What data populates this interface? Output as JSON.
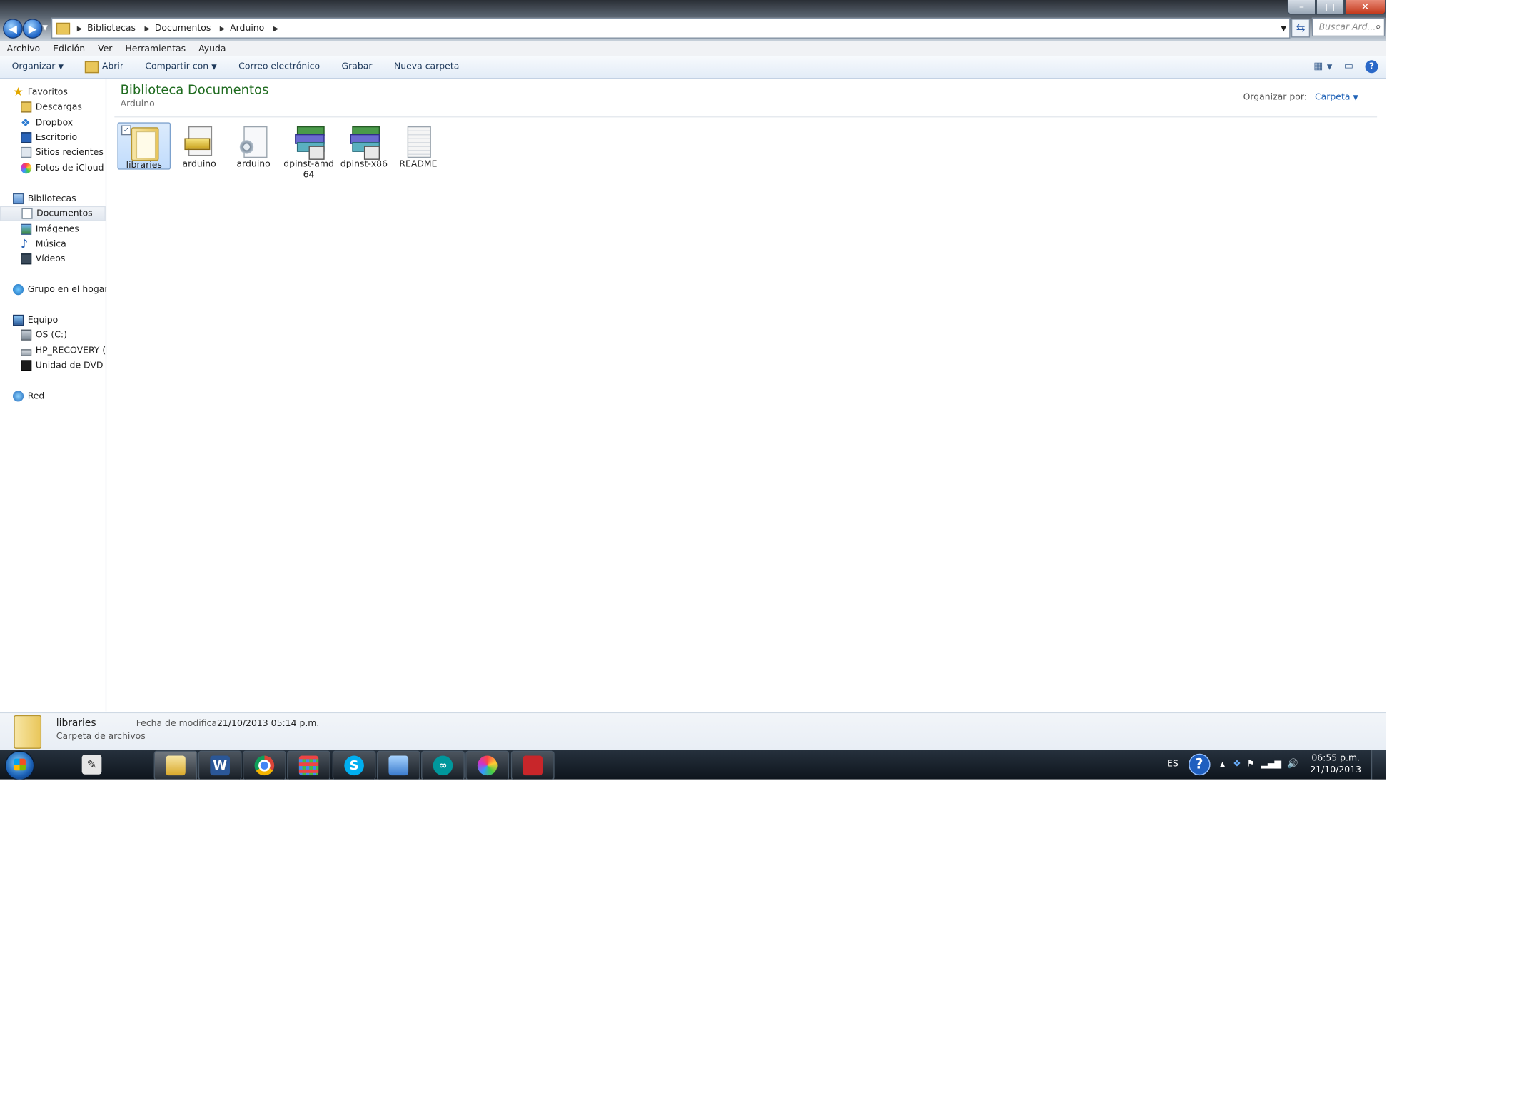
{
  "window": {
    "caption": {
      "minimize": "–",
      "maximize": "□",
      "close": "✕"
    }
  },
  "address_bar": {
    "breadcrumbs": [
      "Bibliotecas",
      "Documentos",
      "Arduino"
    ],
    "search_placeholder": "Buscar Ard..."
  },
  "menu": [
    "Archivo",
    "Edición",
    "Ver",
    "Herramientas",
    "Ayuda"
  ],
  "toolbar": {
    "organize": "Organizar",
    "open": "Abrir",
    "share": "Compartir con",
    "email": "Correo electrónico",
    "burn": "Grabar",
    "new_folder": "Nueva carpeta"
  },
  "sidebar": {
    "favorites": {
      "header": "Favoritos",
      "items": [
        "Descargas",
        "Dropbox",
        "Escritorio",
        "Sitios recientes",
        "Fotos de iCloud"
      ]
    },
    "libraries": {
      "header": "Bibliotecas",
      "items": [
        "Documentos",
        "Imágenes",
        "Música",
        "Vídeos"
      ],
      "selected": "Documentos"
    },
    "homegroup": "Grupo en el hogar",
    "computer": {
      "header": "Equipo",
      "items": [
        "OS (C:)",
        "HP_RECOVERY (D:",
        "Unidad de DVD RV"
      ]
    },
    "network": "Red"
  },
  "content": {
    "title": "Biblioteca Documentos",
    "subtitle": "Arduino",
    "arrange_label": "Organizar por:",
    "arrange_value": "Carpeta",
    "files": [
      {
        "name": "libraries",
        "kind": "folder",
        "selected": true
      },
      {
        "name": "arduino",
        "kind": "exe"
      },
      {
        "name": "arduino",
        "kind": "settings"
      },
      {
        "name": "dpinst-amd64",
        "label": "dpinst-amd\n64",
        "kind": "installer"
      },
      {
        "name": "dpinst-x86",
        "kind": "installer"
      },
      {
        "name": "README",
        "kind": "text"
      }
    ]
  },
  "details": {
    "name": "libraries",
    "type": "Carpeta de archivos",
    "modified_label": "Fecha de modifica...",
    "modified_value": "21/10/2013 05:14 p.m."
  },
  "taskbar": {
    "apps": [
      "pen-tablet",
      "explorer",
      "word",
      "chrome",
      "app-grid",
      "skype",
      "remote-desktop",
      "arduino",
      "paint",
      "toolbox"
    ],
    "language": "ES",
    "time": "06:55 p.m.",
    "date": "21/10/2013"
  },
  "colors": {
    "title_green": "#1f6b1f",
    "accent_blue": "#1f62b7",
    "selection": "#c1dcfc"
  }
}
